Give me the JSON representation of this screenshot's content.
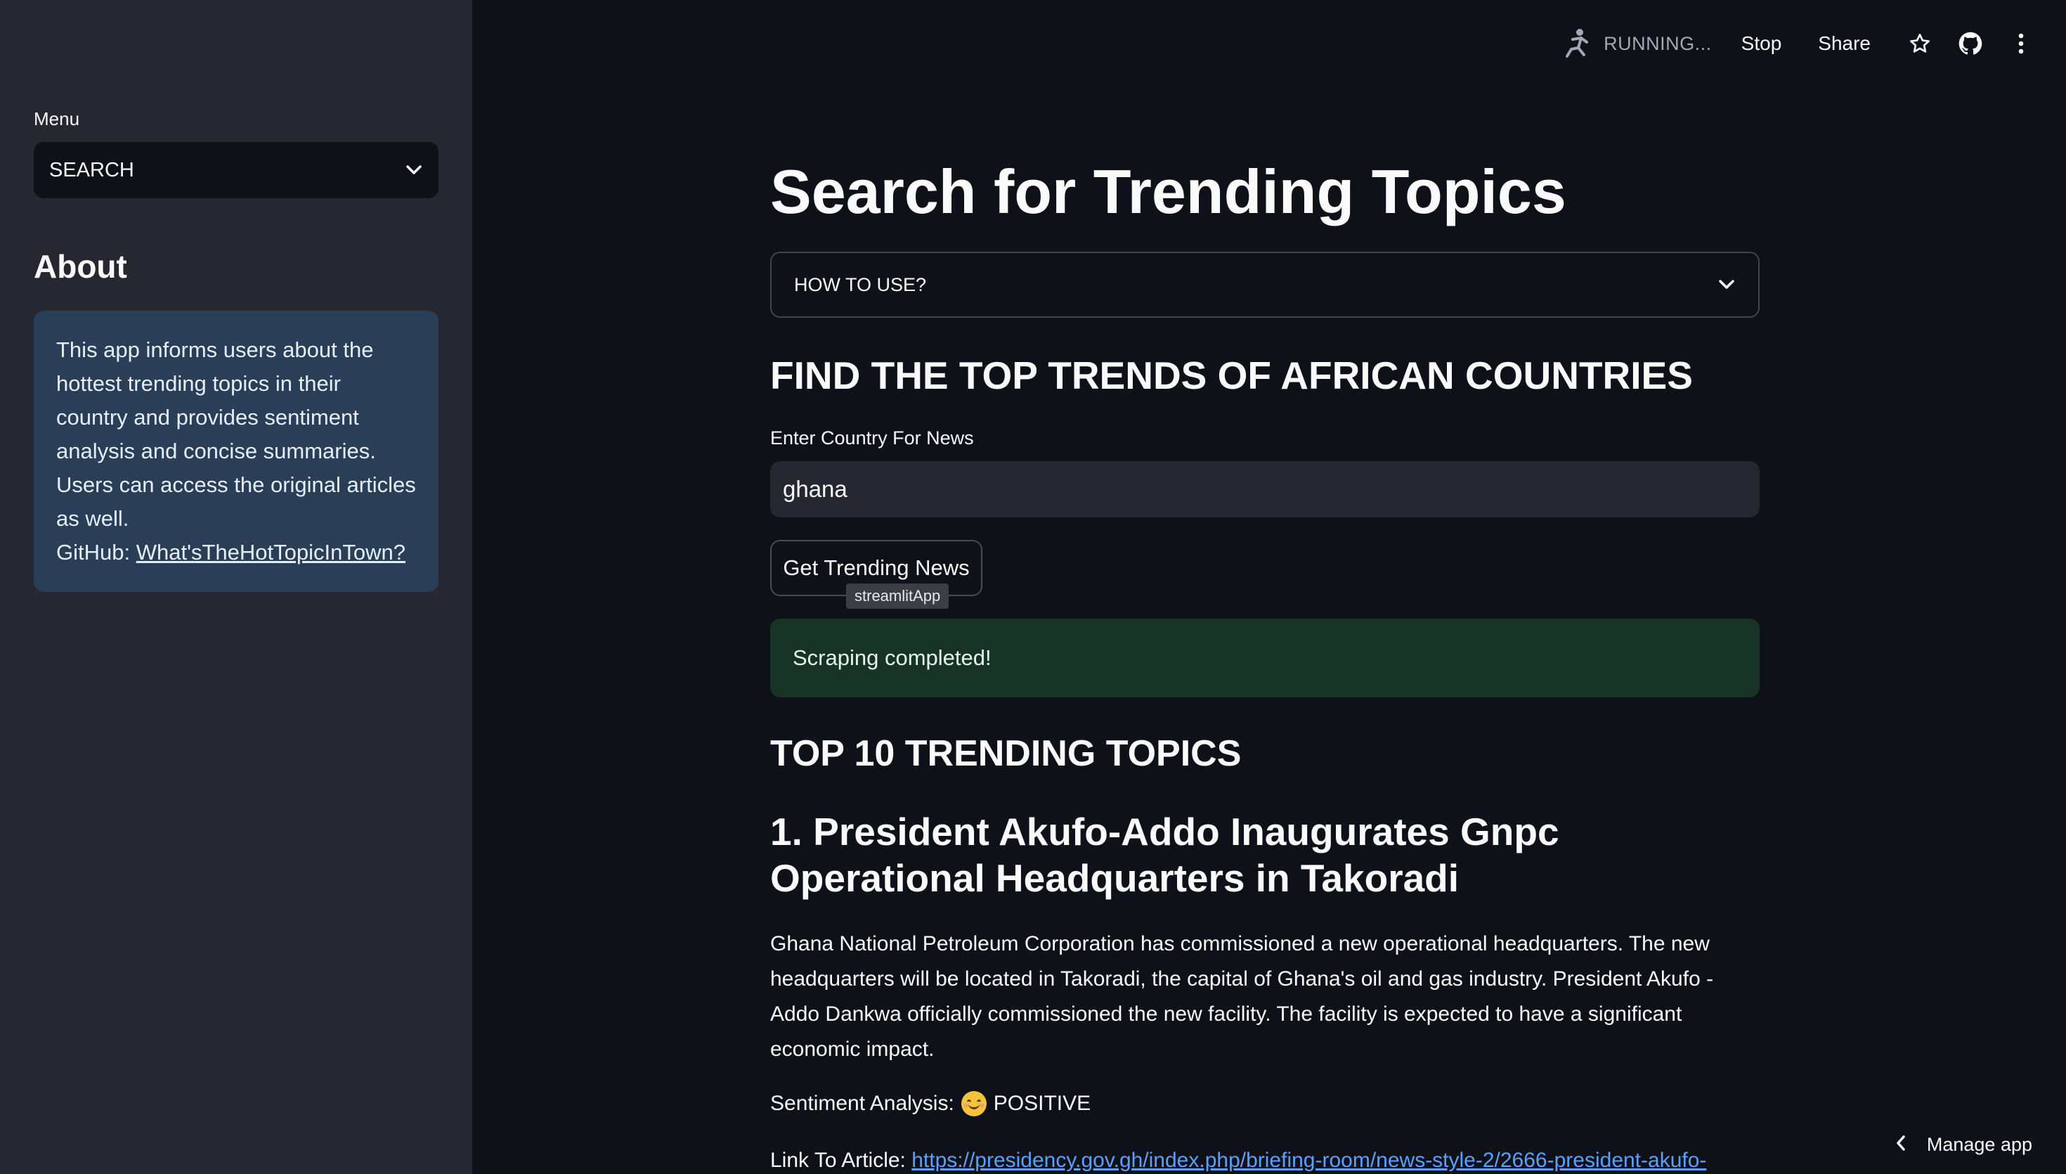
{
  "sidebar": {
    "menu_label": "Menu",
    "menu_value": "SEARCH",
    "about_title": "About",
    "about_text": "This app informs users about the hottest trending topics in their country and provides sentiment analysis and concise summaries. Users can access the original articles as well.",
    "github_label": "GitHub: ",
    "github_link": "What'sTheHotTopicInTown?"
  },
  "toolbar": {
    "status": "RUNNING...",
    "stop": "Stop",
    "share": "Share"
  },
  "main": {
    "title": "Search for Trending Topics",
    "expander_label": "HOW TO USE?",
    "find_heading": "FIND THE TOP TRENDS OF AFRICAN COUNTRIES",
    "input_label": "Enter Country For News",
    "input_value": "ghana",
    "button_label": "Get Trending News",
    "tooltip": "streamlitApp",
    "success_message": "Scraping completed!",
    "top_heading": "TOP 10 TRENDING TOPICS",
    "item": {
      "title": "1. President Akufo-Addo Inaugurates Gnpc Operational Headquarters in Takoradi",
      "summary": "Ghana National Petroleum Corporation has commissioned a new operational headquarters. The new headquarters will be located in Takoradi, the capital of Ghana's oil and gas industry. President Akufo - Addo Dankwa officially commissioned the new facility. The facility is expected to have a significant economic impact.",
      "sentiment_label": "Sentiment Analysis:",
      "sentiment_value": "POSITIVE",
      "link_label": "Link To Article:",
      "link_url": "https://presidency.gov.gh/index.php/briefing-room/news-style-2/2666-president-akufo-"
    }
  },
  "footer": {
    "manage_app": "Manage app"
  },
  "colors": {
    "background": "#0e1117",
    "sidebar": "#262730",
    "info_box": "#2b3a55",
    "success_box": "#1f3a2b",
    "link": "#5aa0ff"
  }
}
